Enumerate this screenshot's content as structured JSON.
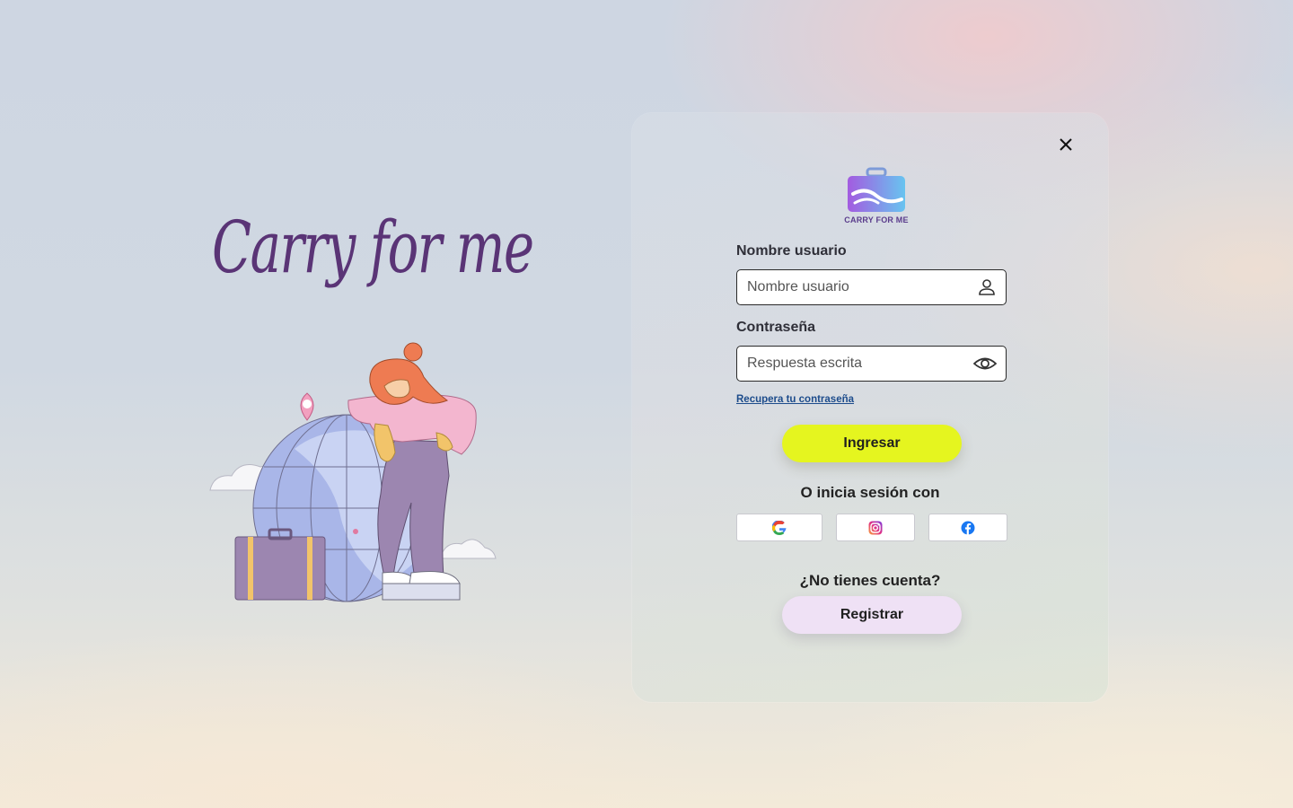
{
  "hero": {
    "title": "Carry for me"
  },
  "card": {
    "logo_text": "CARRY FOR ME",
    "username": {
      "label": "Nombre usuario",
      "placeholder": "Nombre usuario",
      "value": "",
      "icon": "person-icon"
    },
    "password": {
      "label": "Contraseña",
      "placeholder": "Respuesta escrita",
      "value": "",
      "icon": "eye-icon"
    },
    "forgot_link": "Recupera tu contraseña",
    "login_button": "Ingresar",
    "social_title": "O inicia sesión con",
    "social": [
      {
        "name": "google",
        "icon": "google-icon"
      },
      {
        "name": "instagram",
        "icon": "instagram-icon"
      },
      {
        "name": "facebook",
        "icon": "facebook-icon"
      }
    ],
    "no_account": "¿No tienes cuenta?",
    "register_button": "Registrar"
  },
  "colors": {
    "title": "#5a3476",
    "primary_button": "#e5f51f",
    "secondary_button": "#efe1f5",
    "link": "#1d4c8c"
  }
}
